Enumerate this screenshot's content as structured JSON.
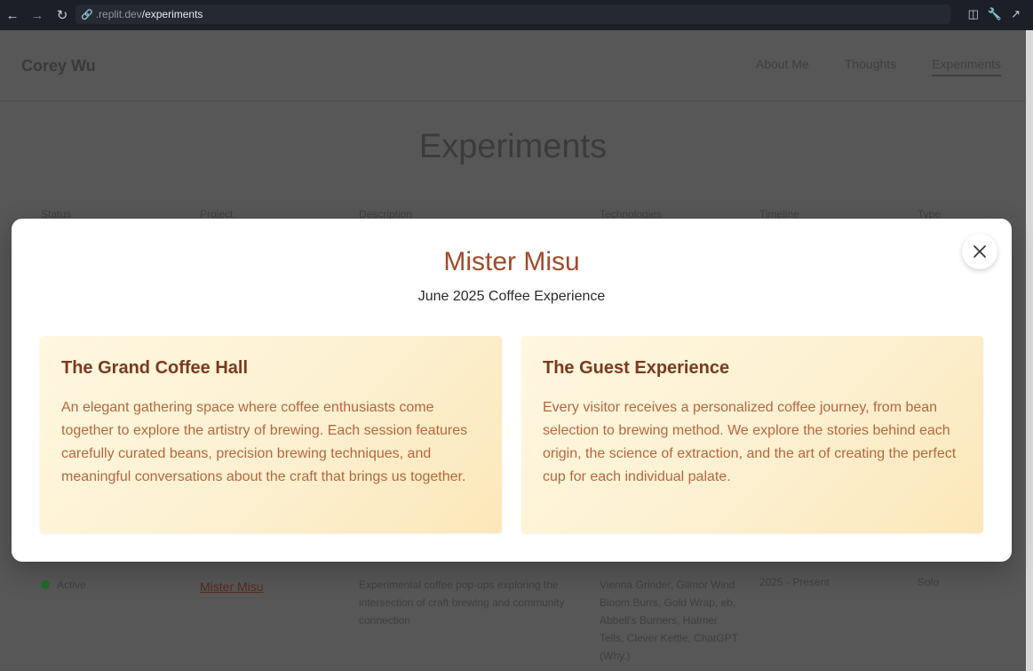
{
  "browser": {
    "url_host": ".replit.dev",
    "url_path": "/experiments"
  },
  "site": {
    "logo": "Corey Wu",
    "nav": [
      {
        "label": "About Me"
      },
      {
        "label": "Thoughts"
      },
      {
        "label": "Experiments"
      }
    ],
    "heading": "Experiments",
    "columns": [
      "Status",
      "Project",
      "Description",
      "Technologies",
      "Timeline",
      "Type"
    ],
    "row": {
      "status": "Active",
      "project": "Mister Misu",
      "description": "Experimental coffee pop-ups exploring the intersection of craft brewing and community connection",
      "technologies": "Vienna Grinder, Gilmor Wind Bloom Burrs, Gold Wrap, eb, Abbell's Burners, Hatmer Tells, Clever Kettle, ChatGPT (Why.)",
      "timeline": "2025 - Present",
      "type": "Solo"
    }
  },
  "modal": {
    "title": "Mister Misu",
    "subtitle": "June 2025 Coffee Experience",
    "cards": [
      {
        "title": "The Grand Coffee Hall",
        "body": "An elegant gathering space where coffee enthusiasts come together to explore the artistry of brewing. Each session features carefully curated beans, precision brewing techniques, and meaningful conversations about the craft that brings us together."
      },
      {
        "title": "The Guest Experience",
        "body": "Every visitor receives a personalized coffee journey, from bean selection to brewing method. We explore the stories behind each origin, the science of extraction, and the art of creating the perfect cup for each individual palate."
      }
    ]
  },
  "icons": {
    "close": "close-icon",
    "back": "back-arrow-icon",
    "forward": "forward-arrow-icon",
    "reload": "reload-icon",
    "link": "link-icon"
  },
  "colors": {
    "accent": "#a14a2a",
    "card_title": "#7b3a1e",
    "card_body": "#b8663c",
    "status_active": "#1f6b2a"
  }
}
